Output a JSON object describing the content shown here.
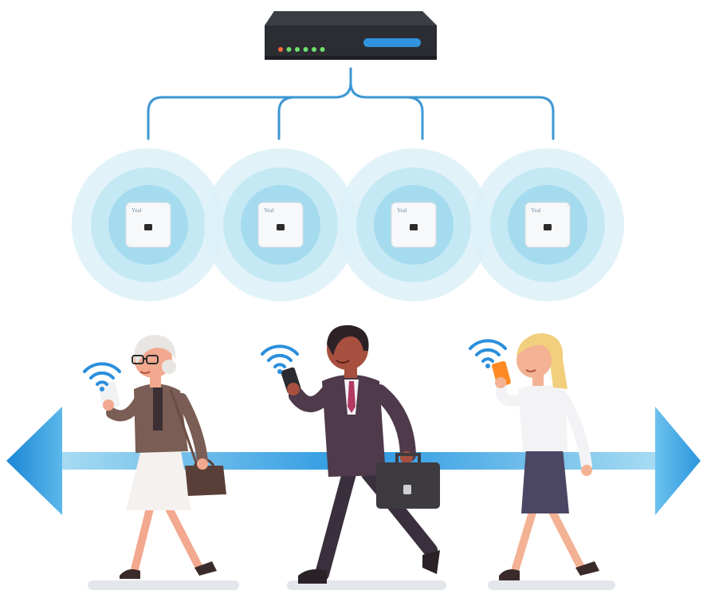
{
  "access_points": {
    "count": 4,
    "brand_label": "Yeal"
  },
  "router": {
    "status_leds": [
      "#ff6a3d",
      "#6fe06b",
      "#6fe06b",
      "#6fe06b",
      "#6fe06b",
      "#6fe06b"
    ],
    "light_bar_color": "#2f93e0"
  },
  "people": [
    {
      "role": "older-woman-walking",
      "device": "phone",
      "wifi": true
    },
    {
      "role": "businessman-walking",
      "device": "phone",
      "wifi": true
    },
    {
      "role": "young-woman-walking",
      "device": "phone",
      "wifi": true
    }
  ],
  "colors": {
    "cable": "#3d97d3",
    "coverage_outer": "#dcf1f8",
    "coverage_mid": "#bfe6f3",
    "coverage_inner": "#90d2ea",
    "arrow": "#1f8fdd",
    "wifi": "#2a8fdc",
    "ground": "#e3e6ea"
  }
}
